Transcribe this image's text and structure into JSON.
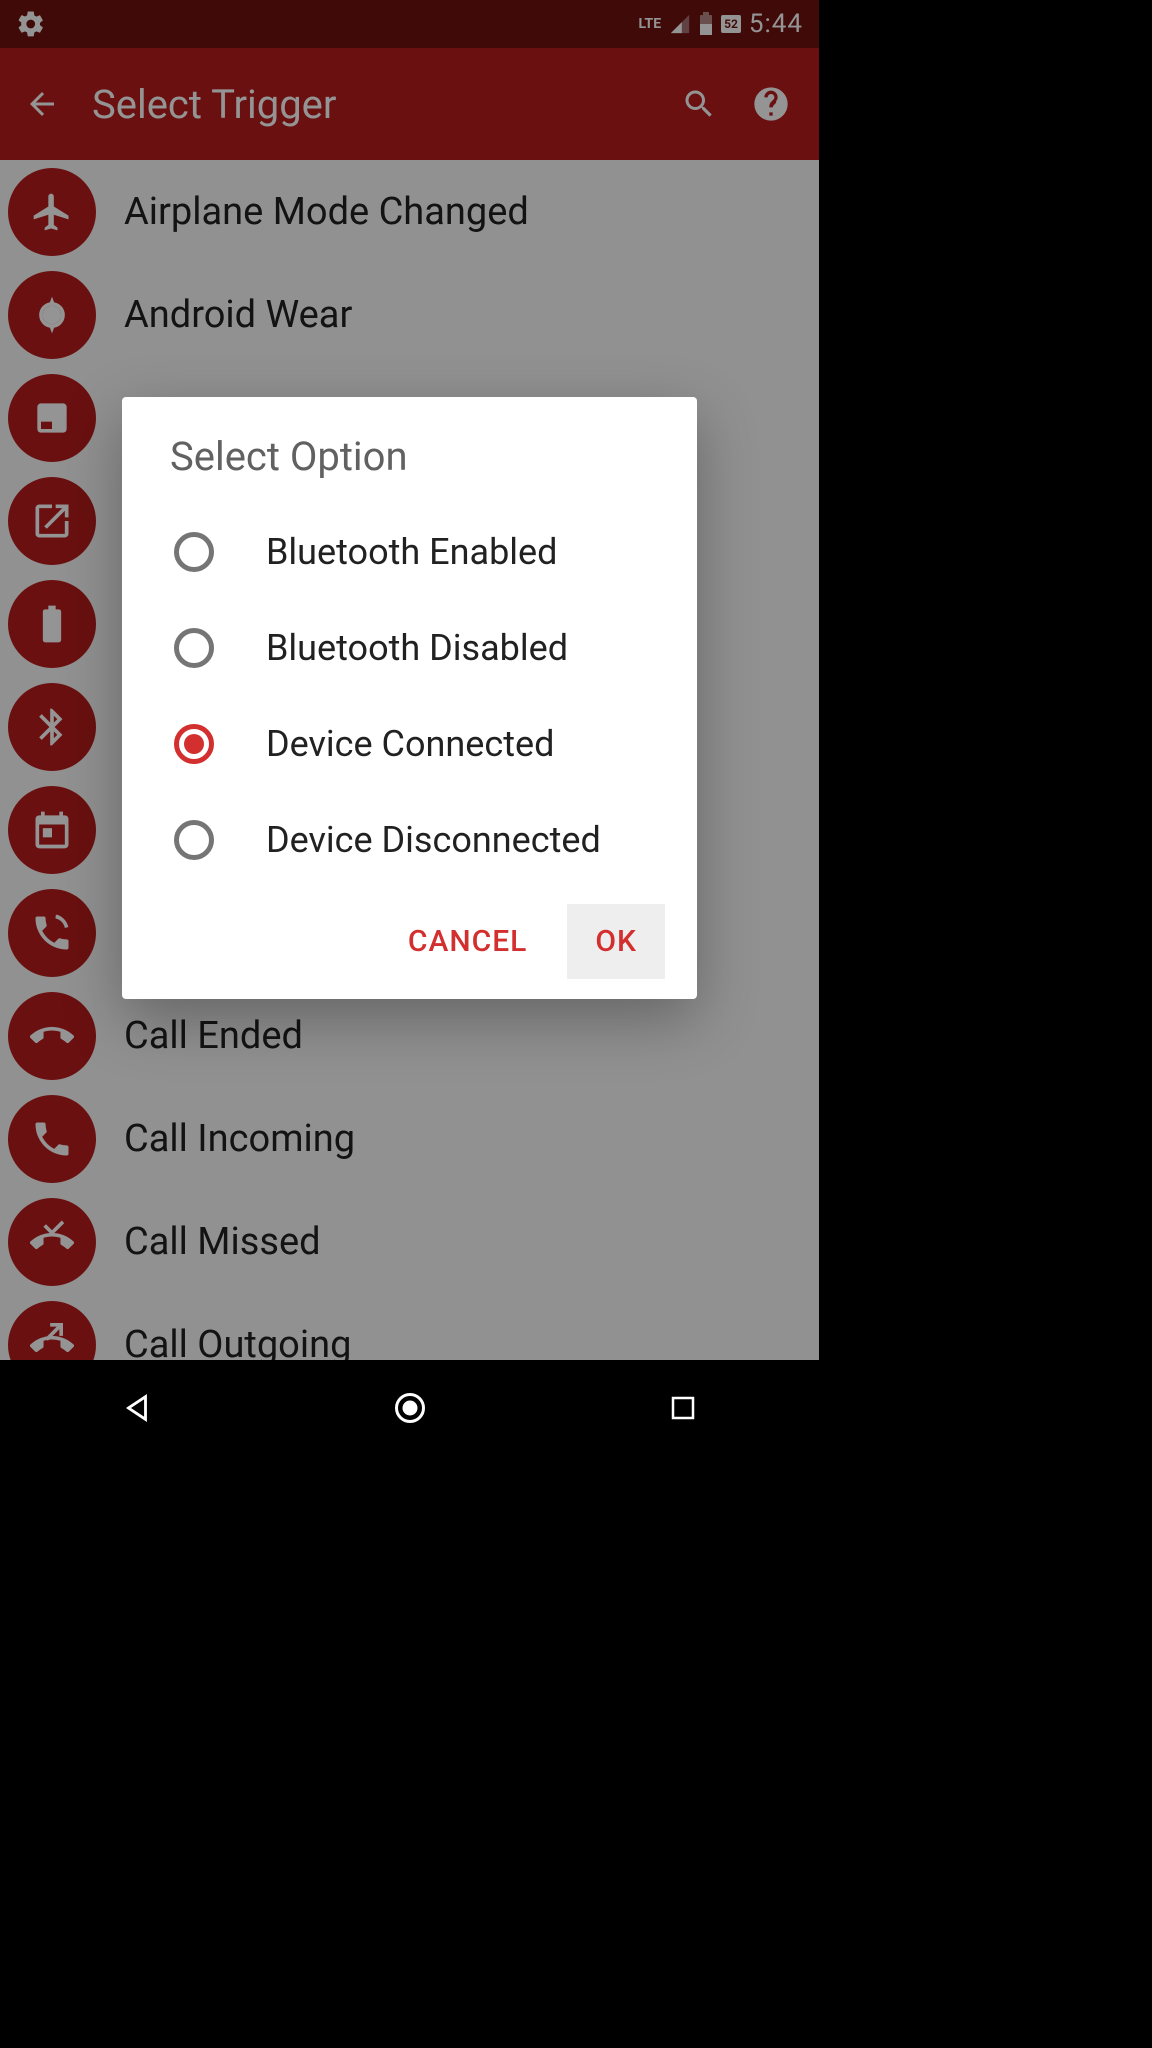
{
  "status": {
    "time": "5:44",
    "network": "LTE",
    "battery_pct": "52"
  },
  "appbar": {
    "title": "Select Trigger"
  },
  "triggers": [
    {
      "label": "Airplane Mode Changed",
      "icon": "airplane"
    },
    {
      "label": "Android Wear",
      "icon": "watch"
    },
    {
      "label": "",
      "icon": "app"
    },
    {
      "label": "",
      "icon": "open-external"
    },
    {
      "label": "",
      "icon": "battery"
    },
    {
      "label": "",
      "icon": "bluetooth"
    },
    {
      "label": "",
      "icon": "calendar"
    },
    {
      "label": "",
      "icon": "call-active"
    },
    {
      "label": "Call Ended",
      "icon": "call-end"
    },
    {
      "label": "Call Incoming",
      "icon": "phone"
    },
    {
      "label": "Call Missed",
      "icon": "call-missed"
    },
    {
      "label": "Call Outgoing",
      "icon": "call-outgoing"
    }
  ],
  "dialog": {
    "title": "Select Option",
    "options": [
      {
        "label": "Bluetooth Enabled",
        "selected": false
      },
      {
        "label": "Bluetooth Disabled",
        "selected": false
      },
      {
        "label": "Device Connected",
        "selected": true
      },
      {
        "label": "Device Disconnected",
        "selected": false
      }
    ],
    "cancel": "CANCEL",
    "ok": "OK"
  }
}
